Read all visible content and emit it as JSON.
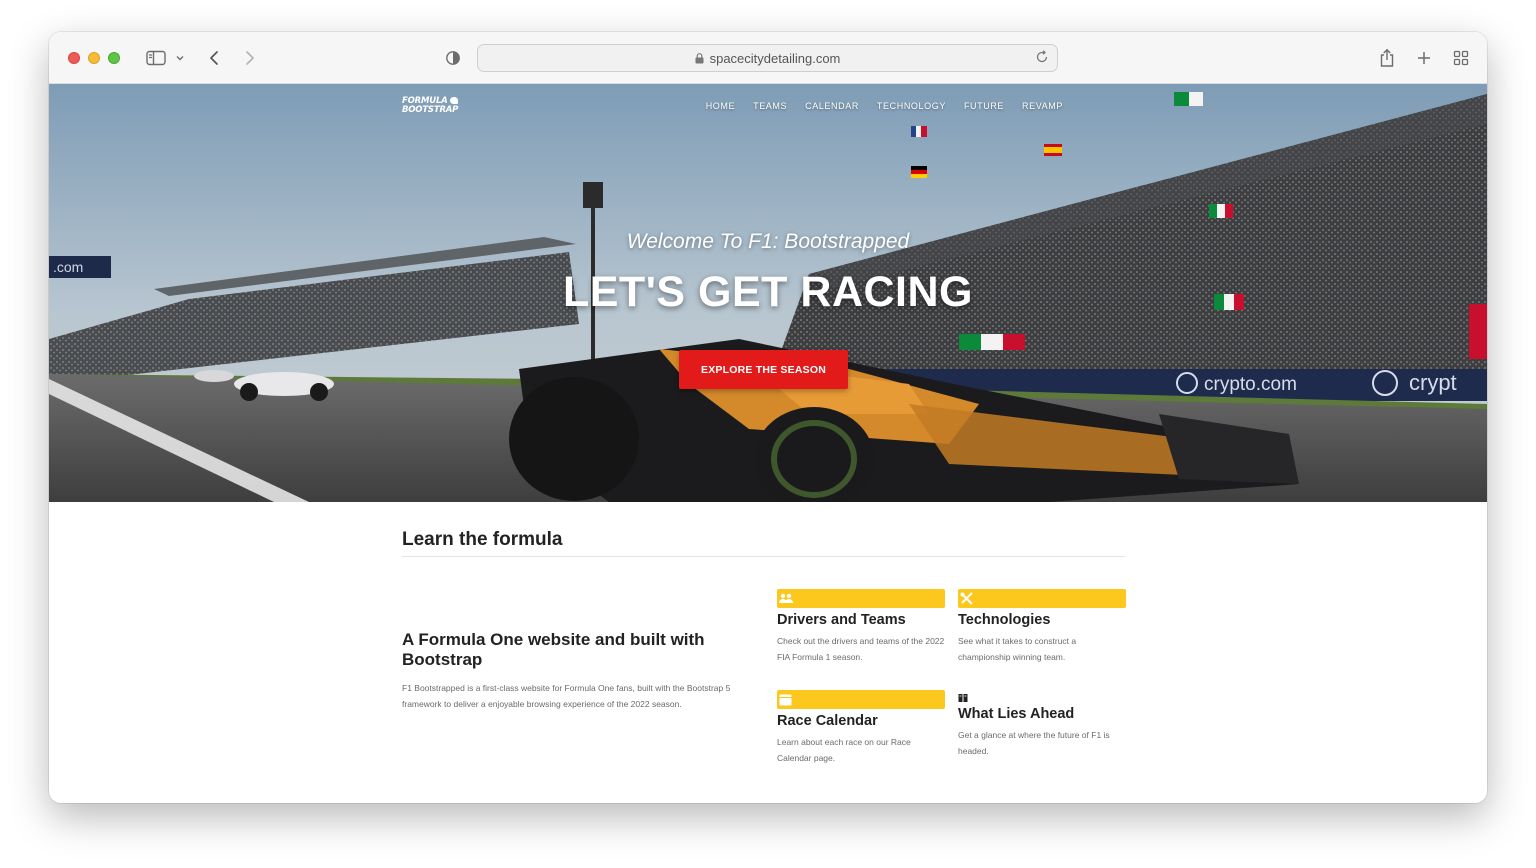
{
  "browser": {
    "url": "spacecitydetailing.com"
  },
  "nav": {
    "logo_line1": "FORMULA",
    "logo_line2": "BOOTSTRAP",
    "links": [
      "HOME",
      "TEAMS",
      "CALENDAR",
      "TECHNOLOGY",
      "FUTURE",
      "REVAMP"
    ]
  },
  "hero": {
    "welcome": "Welcome To F1: Bootstrapped",
    "headline": "LET'S GET RACING",
    "cta_label": "EXPLORE THE SEASON",
    "banner_text": "crypto.com",
    "left_sign_text": ".com",
    "accent_color": "#e21a1a"
  },
  "section": {
    "title": "Learn the formula",
    "intro_title": "A Formula One website and built with Bootstrap",
    "intro_text": "F1 Bootstrapped is a first-class website for Formula One fans, built with the Bootstrap 5 framework to deliver a enjoyable browsing experience of the 2022 season."
  },
  "cards": [
    {
      "icon": "people-icon",
      "title": "Drivers and Teams",
      "text": "Check out the drivers and teams of the 2022 FIA Formula 1 season."
    },
    {
      "icon": "tools-icon",
      "title": "Technologies",
      "text": "See what it takes to construct a championship winning team."
    },
    {
      "icon": "calendar-icon",
      "title": "Race Calendar",
      "text": "Learn about each race on our Race Calendar page."
    },
    {
      "icon": "book-icon",
      "title": "What Lies Ahead",
      "text": "Get a glance at where the future of F1 is headed."
    }
  ],
  "colors": {
    "card_accent": "#fcc81e"
  }
}
